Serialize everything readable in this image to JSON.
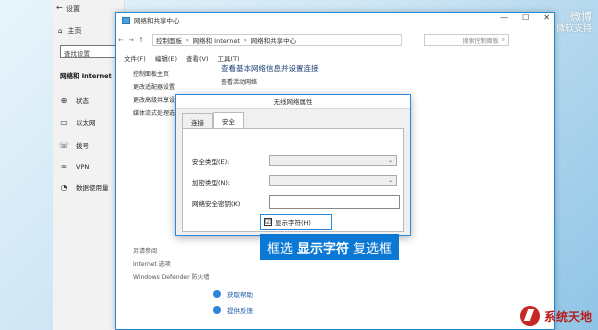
{
  "settings": {
    "back_glyph": "←",
    "title": "设置",
    "home": "主页",
    "search_placeholder": "查找设置",
    "section": "网络和 Internet",
    "items": [
      {
        "icon": "globe-icon",
        "glyph": "⊕",
        "label": "状态"
      },
      {
        "icon": "ethernet-icon",
        "glyph": "▭",
        "label": "以太网"
      },
      {
        "icon": "dialup-icon",
        "glyph": "☏",
        "label": "拨号"
      },
      {
        "icon": "vpn-icon",
        "glyph": "∞",
        "label": "VPN"
      },
      {
        "icon": "data-usage-icon",
        "glyph": "◔",
        "label": "数据使用量"
      }
    ]
  },
  "nsc": {
    "title": "网络和共享中心",
    "win_controls": [
      "—",
      "☐",
      "✕"
    ],
    "address": [
      "控制面板",
      "网络和 Internet",
      "网络和共享中心"
    ],
    "search_placeholder": "搜索控制面板",
    "menu": [
      "文件(F)",
      "编辑(E)",
      "查看(V)",
      "工具(T)"
    ],
    "left_links": [
      "控制面板主页",
      "更改适配器设置",
      "更改高级共享设置",
      "媒体流式处理选项"
    ],
    "main_heading": "查看基本网络信息并设置连接",
    "main_sub": "查看活动网络",
    "see_also_title": "另请参阅",
    "see_also": [
      "Internet 选项",
      "Windows Defender 防火墙"
    ],
    "bottom_links": [
      "获取帮助",
      "提供反馈"
    ]
  },
  "dialog": {
    "title": "无线网络属性",
    "tabs": [
      "连接",
      "安全"
    ],
    "active_tab": 1,
    "security_type_label": "安全类型(E):",
    "encryption_type_label": "加密类型(N):",
    "key_label": "网络安全密钥(K)",
    "show_chars_label": "显示字符(H)",
    "show_chars_checked": "☑"
  },
  "caption": {
    "part1": "框选",
    "highlight": "显示字符",
    "part2": "复选框"
  },
  "watermark": {
    "weibo": "微博",
    "weibo_sub": "微软支持",
    "site": "系统天地"
  }
}
